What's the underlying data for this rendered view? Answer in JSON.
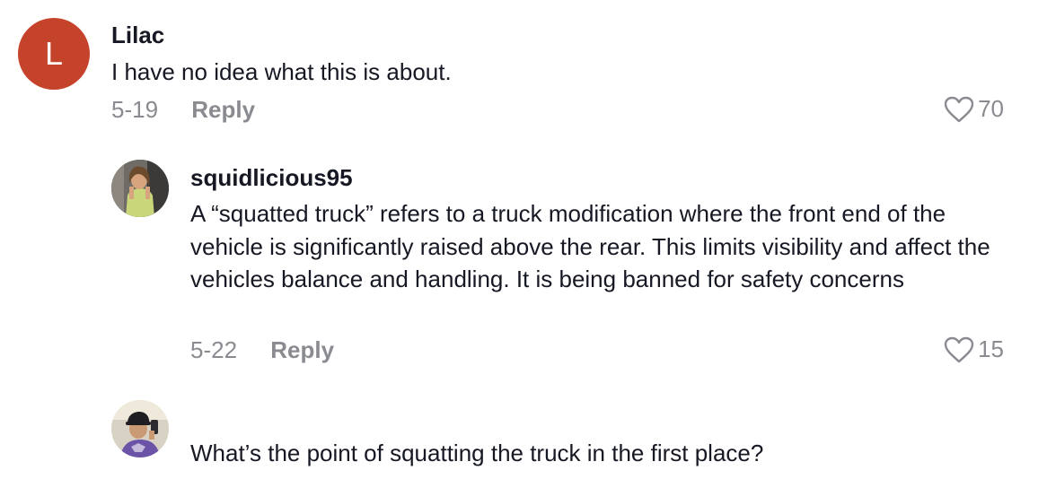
{
  "comments": [
    {
      "avatar_letter": "L",
      "username": "Lilac",
      "text": "I have no idea what this is about.",
      "date": "5-19",
      "reply_label": "Reply",
      "likes": "70"
    },
    {
      "username": "squidlicious95",
      "text": "A “squatted truck” refers to a truck modification where the front end of the vehicle is significantly raised above the rear. This limits visibility and affect the vehicles balance and handling. It is being banned for safety concerns",
      "date": "5-22",
      "reply_label": "Reply",
      "likes": "15"
    },
    {
      "text": "What’s the point of squatting the truck in the first place?"
    }
  ],
  "colors": {
    "avatar_bg": "#c5432a",
    "muted": "#8a8b91",
    "text": "#161823"
  }
}
